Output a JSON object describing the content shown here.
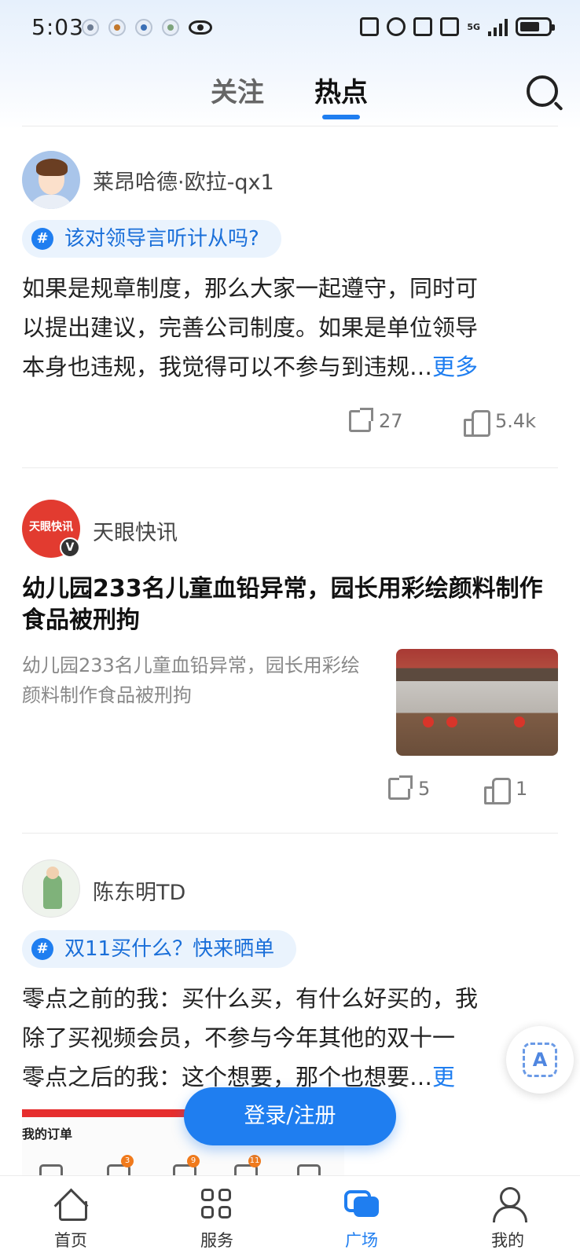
{
  "status_bar": {
    "time": "5:03",
    "network": "5G"
  },
  "header": {
    "tabs": [
      {
        "label": "关注",
        "active": false
      },
      {
        "label": "热点",
        "active": true
      }
    ],
    "search_icon": "search-icon"
  },
  "feed": [
    {
      "type": "opinion",
      "author": "莱昂哈德·欧拉-qx1",
      "topic": "该对领导言听计从吗?",
      "text_lines": [
        "如果是规章制度，那么大家一起遵守，同时可",
        "以提出建议，完善公司制度。如果是单位领导",
        "本身也违规，我觉得可以不参与到违规…"
      ],
      "more": "更多",
      "shares": "27",
      "likes": "5.4k"
    },
    {
      "type": "news",
      "author": "天眼快讯",
      "avatar_text": "天眼快讯",
      "verified": "V",
      "headline": "幼儿园233名儿童血铅异常，园长用彩绘颜料制作食品被刑拘",
      "summary": "幼儿园233名儿童血铅异常，园长用彩绘颜料制作食品被刑拘",
      "shares": "5",
      "likes": "1"
    },
    {
      "type": "opinion",
      "author": "陈东明TD",
      "topic": "双11买什么？快来晒单",
      "text_lines": [
        "零点之前的我：买什么买，有什么好买的，我",
        "除了买视频会员，不参与今年其他的双十一",
        "零点之后的我：这个想要，那个也想要…"
      ],
      "more": "更",
      "promo_title": "我的订单",
      "promo_badges": [
        "3",
        "9",
        "11"
      ]
    }
  ],
  "floating": {
    "login_button": "登录/注册",
    "scan_label": "A"
  },
  "bottom_nav": [
    {
      "label": "首页",
      "icon": "home-icon",
      "active": false
    },
    {
      "label": "服务",
      "icon": "grid-icon",
      "active": false
    },
    {
      "label": "广场",
      "icon": "chat-icon",
      "active": true
    },
    {
      "label": "我的",
      "icon": "user-icon",
      "active": false
    }
  ],
  "colors": {
    "accent": "#1f7ef0",
    "topic_bg": "#eaf3fd",
    "news_red": "#e23b30"
  }
}
